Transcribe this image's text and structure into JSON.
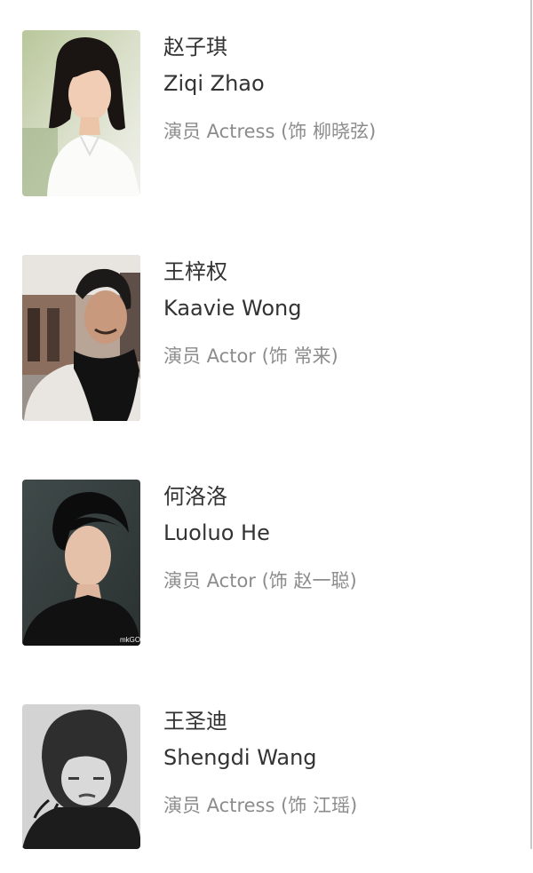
{
  "cast": [
    {
      "name_zh": "赵子琪",
      "name_en": "Ziqi Zhao",
      "role": "演员 Actress (饰 柳晓弦)",
      "photo_icon": "actress-portrait"
    },
    {
      "name_zh": "王梓权",
      "name_en": "Kaavie Wong",
      "role": "演员 Actor (饰 常来)",
      "photo_icon": "actor-portrait"
    },
    {
      "name_zh": "何洛洛",
      "name_en": "Luoluo He",
      "role": "演员 Actor (饰 赵一聪)",
      "photo_icon": "actor-portrait",
      "photo_watermark": "mkGO"
    },
    {
      "name_zh": "王圣迪",
      "name_en": "Shengdi Wang",
      "role": "演员 Actress (饰 江瑶)",
      "photo_icon": "actress-portrait"
    }
  ]
}
